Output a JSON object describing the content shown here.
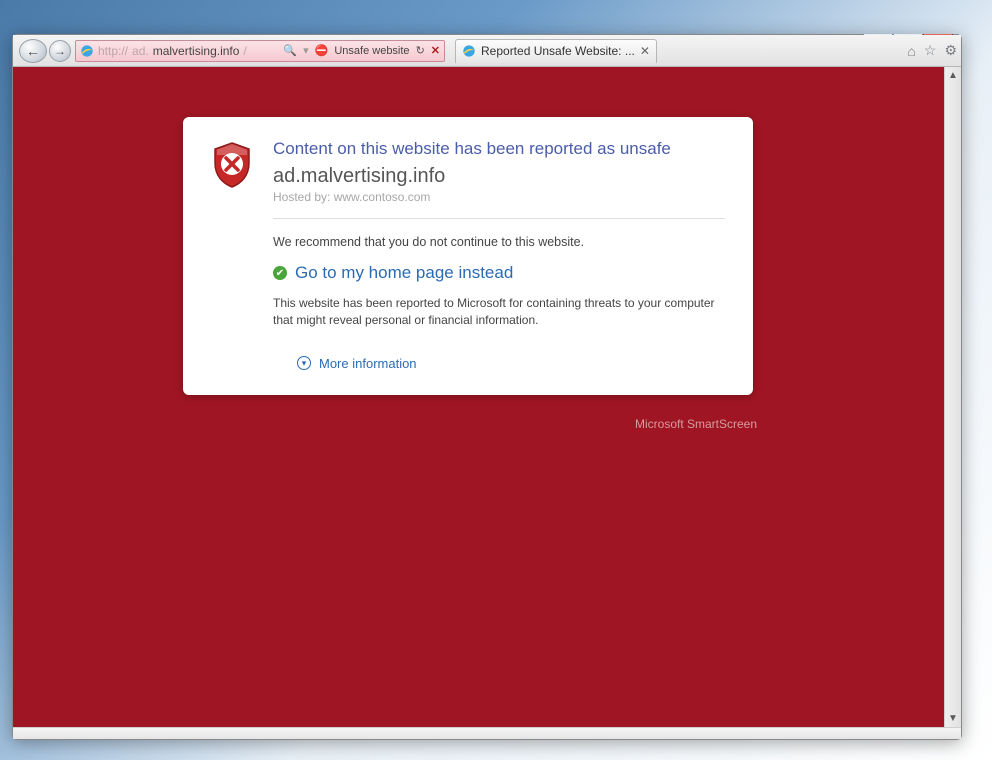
{
  "window": {
    "minimize_tip": "Minimize",
    "maximize_tip": "Maximize",
    "close_tip": "Close"
  },
  "nav": {
    "back_tip": "Back",
    "forward_tip": "Forward"
  },
  "address": {
    "scheme": "http://",
    "sub": "ad.",
    "domain": "malvertising.info",
    "path": "/",
    "search_tip": "Search",
    "warn_label": "Unsafe website",
    "refresh_tip": "Refresh",
    "stop_tip": "Stop"
  },
  "tab": {
    "title": "Reported Unsafe Website: ...",
    "close_tip": "Close Tab"
  },
  "chrome": {
    "home_tip": "Home",
    "fav_tip": "Favorites",
    "tools_tip": "Tools"
  },
  "card": {
    "heading": "Content on this website has been reported as unsafe",
    "domain": "ad.malvertising.info",
    "hosted_label": "Hosted by:",
    "hosted_value": "www.contoso.com",
    "recommend": "We recommend that you do not continue to this website.",
    "home_link": "Go to my home page instead",
    "description": "This website has been reported to Microsoft for containing threats to your computer that might reveal personal or financial information.",
    "more_info": "More information"
  },
  "brand": "Microsoft SmartScreen"
}
